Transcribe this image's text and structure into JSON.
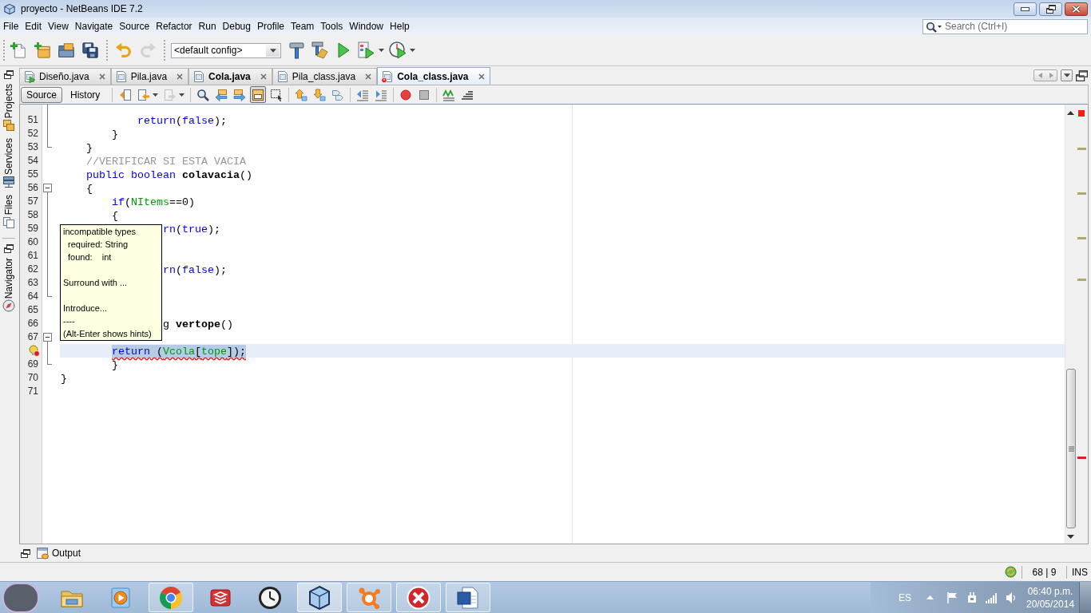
{
  "window": {
    "title": "proyecto - NetBeans IDE 7.2"
  },
  "menu": [
    "File",
    "Edit",
    "View",
    "Navigate",
    "Source",
    "Refactor",
    "Run",
    "Debug",
    "Profile",
    "Team",
    "Tools",
    "Window",
    "Help"
  ],
  "search": {
    "placeholder": "Search (Ctrl+I)"
  },
  "toolbar": {
    "file_buttons": [
      {
        "disabled": false
      },
      {
        "disabled": false
      },
      {
        "disabled": false
      },
      {
        "disabled": false
      }
    ],
    "edit_buttons": [
      {
        "disabled": false
      },
      {
        "disabled": true
      }
    ],
    "config": "<default config>",
    "run_buttons": [
      {
        "menu": false
      },
      {
        "menu": false
      },
      {
        "menu": false
      },
      {
        "menu": true
      },
      {
        "menu": true
      }
    ]
  },
  "side_panels": [
    {
      "tabs": [
        "Projects",
        "Services",
        "Files"
      ]
    },
    {
      "tabs": [
        "Navigator"
      ]
    }
  ],
  "editor_tabs": [
    {
      "label": "Diseño.java",
      "selected": false,
      "modified": false,
      "runnable": true,
      "error": false
    },
    {
      "label": "Pila.java",
      "selected": false,
      "modified": false,
      "runnable": false,
      "error": false
    },
    {
      "label": "Cola.java",
      "selected": false,
      "modified": true,
      "runnable": false,
      "error": false
    },
    {
      "label": "Pila_class.java",
      "selected": false,
      "modified": false,
      "runnable": false,
      "error": false
    },
    {
      "label": "Cola_class.java",
      "selected": true,
      "modified": true,
      "runnable": false,
      "error": true
    }
  ],
  "editor_toolbar": {
    "views": [
      {
        "label": "Source",
        "selected": true
      },
      {
        "label": "History",
        "selected": false
      }
    ],
    "groups": [
      [
        {
          "pressed": false,
          "disabled": false,
          "menu": false
        },
        {
          "pressed": false,
          "disabled": false,
          "menu": true
        },
        {
          "pressed": false,
          "disabled": true,
          "menu": true
        }
      ],
      [
        {
          "pressed": false,
          "disabled": false,
          "menu": false
        },
        {
          "pressed": false,
          "disabled": false,
          "menu": false
        },
        {
          "pressed": false,
          "disabled": false,
          "menu": false
        },
        {
          "pressed": true,
          "disabled": false,
          "menu": false
        },
        {
          "pressed": false,
          "disabled": false,
          "menu": false
        }
      ],
      [
        {
          "pressed": false,
          "disabled": false,
          "menu": false
        },
        {
          "pressed": false,
          "disabled": false,
          "menu": false
        },
        {
          "pressed": false,
          "disabled": false,
          "menu": false
        }
      ],
      [
        {
          "pressed": false,
          "disabled": false,
          "menu": false
        },
        {
          "pressed": false,
          "disabled": false,
          "menu": false
        }
      ],
      [
        {
          "pressed": false,
          "disabled": false,
          "menu": false
        },
        {
          "pressed": false,
          "disabled": false,
          "menu": false
        }
      ],
      [
        {
          "pressed": false,
          "disabled": false,
          "menu": false
        },
        {
          "pressed": false,
          "disabled": false,
          "menu": false
        }
      ]
    ]
  },
  "code": {
    "lines": [
      {
        "number": "51",
        "kind": "body",
        "current": false,
        "selected": false,
        "error": false,
        "tokens": [
          {
            "text": "            return",
            "kind": "keyword"
          },
          {
            "text": "(",
            "kind": "plain"
          },
          {
            "text": "false",
            "kind": "keyword"
          },
          {
            "text": ");",
            "kind": "plain"
          }
        ]
      },
      {
        "number": "52",
        "kind": "body",
        "current": false,
        "selected": false,
        "error": false,
        "tokens": [
          {
            "text": "        }",
            "kind": "plain"
          }
        ]
      },
      {
        "number": "53",
        "kind": "closer",
        "current": false,
        "selected": false,
        "error": false,
        "tokens": [
          {
            "text": "    }",
            "kind": "plain"
          }
        ]
      },
      {
        "number": "54",
        "kind": "plain",
        "current": false,
        "selected": false,
        "error": false,
        "tokens": [
          {
            "text": "    //VERIFICAR SI ESTA VACIA",
            "kind": "comment"
          }
        ]
      },
      {
        "number": "55",
        "kind": "plain",
        "current": false,
        "selected": false,
        "error": false,
        "tokens": [
          {
            "text": "    public boolean",
            "kind": "keyword"
          },
          {
            "text": " colavacia",
            "kind": "method"
          },
          {
            "text": "()",
            "kind": "plain"
          }
        ]
      },
      {
        "number": "56",
        "kind": "opener",
        "current": false,
        "selected": false,
        "error": false,
        "tokens": [
          {
            "text": "    {",
            "kind": "plain"
          }
        ]
      },
      {
        "number": "57",
        "kind": "body",
        "current": false,
        "selected": false,
        "error": false,
        "tokens": [
          {
            "text": "        if",
            "kind": "keyword"
          },
          {
            "text": "(",
            "kind": "plain"
          },
          {
            "text": "NItems",
            "kind": "field"
          },
          {
            "text": "==0)",
            "kind": "plain"
          }
        ]
      },
      {
        "number": "58",
        "kind": "body",
        "current": false,
        "selected": false,
        "error": false,
        "tokens": [
          {
            "text": "        {",
            "kind": "plain"
          }
        ]
      },
      {
        "number": "59",
        "kind": "body",
        "current": false,
        "selected": false,
        "error": false,
        "tokens": [
          {
            "text": "                rn",
            "kind": "keyword"
          },
          {
            "text": "(",
            "kind": "plain"
          },
          {
            "text": "true",
            "kind": "keyword"
          },
          {
            "text": ");",
            "kind": "plain"
          }
        ]
      },
      {
        "number": "60",
        "kind": "body",
        "current": false,
        "error": false
      },
      {
        "number": "61",
        "kind": "body",
        "current": false,
        "error": false
      },
      {
        "number": "62",
        "kind": "body",
        "current": false,
        "selected": false,
        "error": false,
        "tokens": [
          {
            "text": "                rn",
            "kind": "keyword"
          },
          {
            "text": "(",
            "kind": "plain"
          },
          {
            "text": "false",
            "kind": "keyword"
          },
          {
            "text": ");",
            "kind": "plain"
          }
        ]
      },
      {
        "number": "63",
        "kind": "body",
        "current": false,
        "error": false
      },
      {
        "number": "64",
        "kind": "closer",
        "current": false,
        "error": false
      },
      {
        "number": "65",
        "kind": "plain",
        "current": false,
        "error": false
      },
      {
        "number": "66",
        "kind": "plain",
        "current": false,
        "selected": false,
        "error": false,
        "tokens": [
          {
            "text": "                g",
            "kind": "plain"
          },
          {
            "text": " vertope",
            "kind": "method"
          },
          {
            "text": "()",
            "kind": "plain"
          }
        ]
      },
      {
        "number": "67",
        "kind": "opener",
        "current": false,
        "error": false
      },
      {
        "kind": "body",
        "current": true,
        "selected": true,
        "error": true,
        "tokens": [
          {
            "text": "        return",
            "kind": "keyword"
          },
          {
            "text": " (",
            "kind": "plain"
          },
          {
            "text": "Vcola",
            "kind": "field"
          },
          {
            "text": "[",
            "kind": "plain"
          },
          {
            "text": "tope",
            "kind": "field"
          },
          {
            "text": "]);",
            "kind": "plain"
          }
        ]
      },
      {
        "number": "69",
        "kind": "closer",
        "current": false,
        "selected": false,
        "error": false,
        "tokens": [
          {
            "text": "        }",
            "kind": "plain"
          }
        ]
      },
      {
        "number": "70",
        "kind": "plain",
        "current": false,
        "selected": false,
        "error": false,
        "tokens": [
          {
            "text": "}",
            "kind": "plain"
          }
        ]
      },
      {
        "number": "71",
        "kind": "plain",
        "current": false,
        "error": false
      }
    ]
  },
  "tooltip": {
    "sections": [
      {
        "lines": [
          {
            "text": "incompatible types",
            "kind": "message"
          },
          {
            "text": "required: String",
            "kind": "detail"
          },
          {
            "text": "found:    int",
            "kind": "detail"
          }
        ]
      },
      {
        "lines": [
          {
            "text": "Surround with ...",
            "kind": "action"
          }
        ]
      },
      {
        "lines": [
          {
            "text": "Introduce...",
            "kind": "action"
          },
          {
            "text": "----",
            "kind": "note"
          },
          {
            "text": "(Alt-Enter shows hints)",
            "kind": "note"
          }
        ]
      }
    ]
  },
  "output_bar": {
    "label": "Output"
  },
  "status_bar": {
    "position": "68 | 9",
    "mode": "INS"
  },
  "taskbar": {
    "apps": [
      {
        "running": false,
        "active": false
      },
      {
        "running": false,
        "active": false
      },
      {
        "running": true,
        "active": false
      },
      {
        "running": false,
        "active": false
      },
      {
        "running": false,
        "active": false
      },
      {
        "running": true,
        "active": true
      },
      {
        "running": true,
        "active": false
      },
      {
        "running": true,
        "active": false
      },
      {
        "running": true,
        "active": false
      }
    ],
    "tray": {
      "language": "ES",
      "time": "06:40 p.m.",
      "date": "20/05/2014"
    }
  }
}
